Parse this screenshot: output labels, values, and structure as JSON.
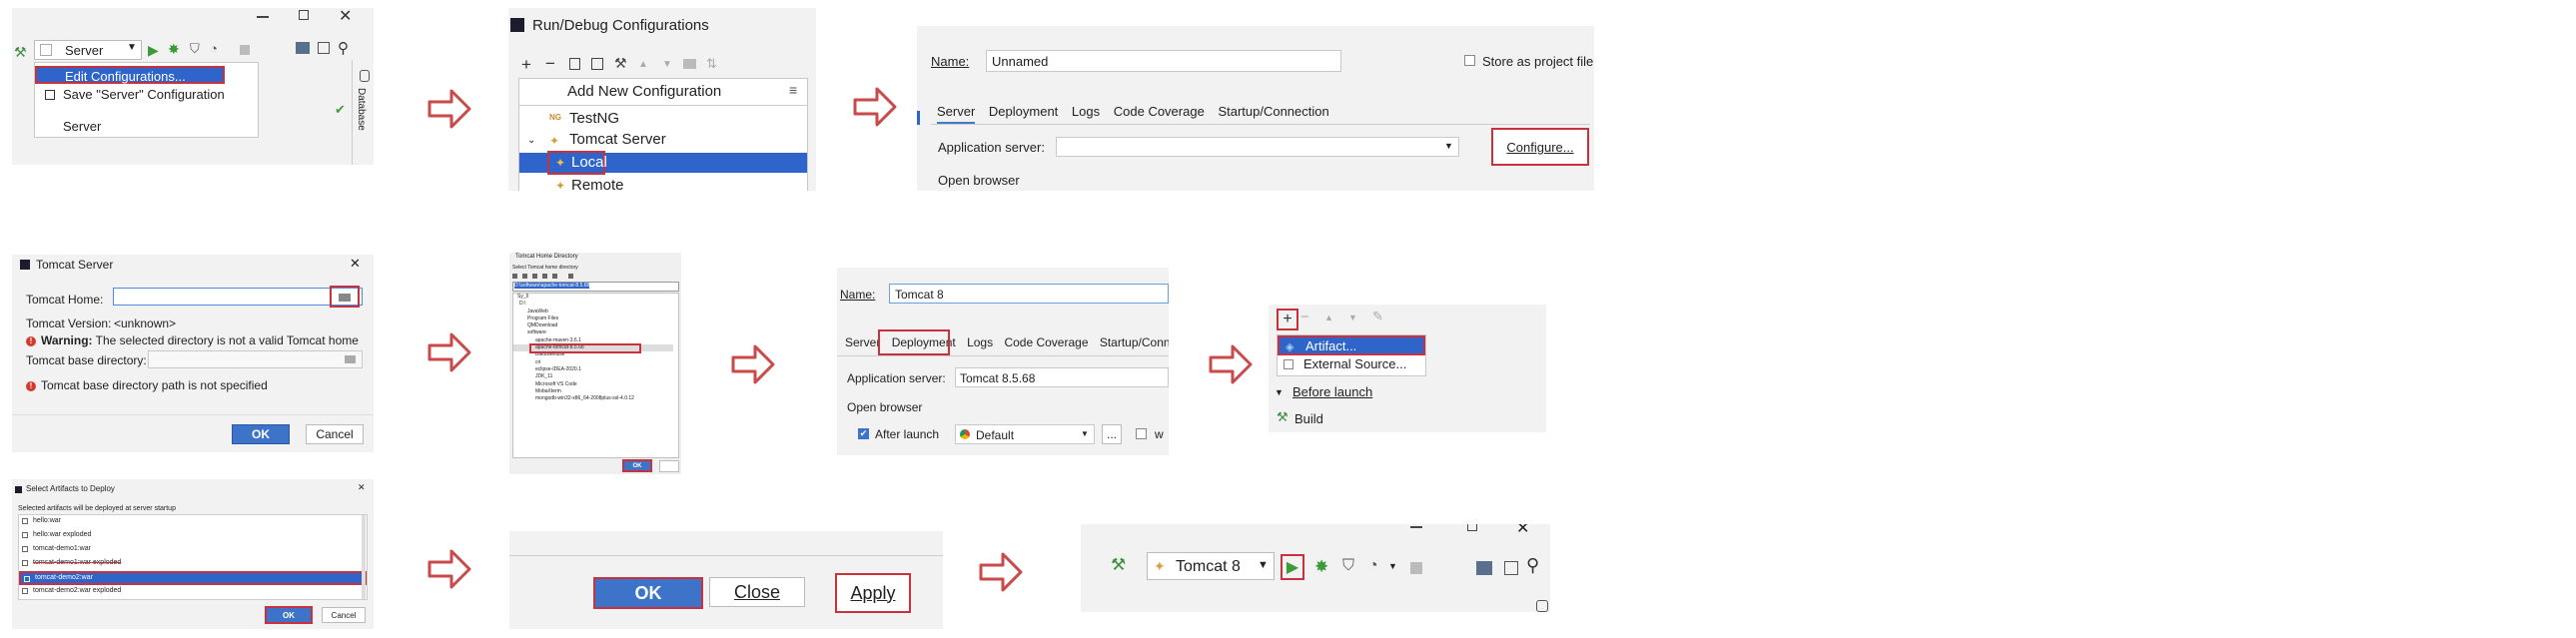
{
  "panel1": {
    "config_name": "Server",
    "menu_edit": "Edit Configurations...",
    "menu_save": "Save \"Server\" Configuration",
    "menu_server": "Server",
    "database_label": "Database"
  },
  "panel2": {
    "title": "Run/Debug Configurations",
    "add_new": "Add New Configuration",
    "testng": "TestNG",
    "tomcat_server": "Tomcat Server",
    "local": "Local",
    "remote": "Remote"
  },
  "panel3": {
    "name_label": "Name:",
    "name_value": "Unnamed",
    "store_label": "Store as project file",
    "tabs": [
      "Server",
      "Deployment",
      "Logs",
      "Code Coverage",
      "Startup/Connection"
    ],
    "app_server_label": "Application server:",
    "configure_btn": "Configure...",
    "open_browser": "Open browser"
  },
  "panel4": {
    "title": "Tomcat Server",
    "home_label": "Tomcat Home:",
    "version_label": "Tomcat Version:",
    "version_value": "<unknown>",
    "warning_bold": "Warning:",
    "warning_text": "The selected directory is not a valid Tomcat home",
    "base_label": "Tomcat base directory:",
    "base_error": "Tomcat base directory path is not specified",
    "ok": "OK",
    "cancel": "Cancel"
  },
  "panel5": {
    "title": "Tomcat Home Directory",
    "subtitle": "Select Tomcat home directory",
    "path": "D:\\software\\apache-tomcat-8.5.68",
    "tree": [
      "Sy_ll",
      "D:\\",
      "JavaWeb",
      "Program Files",
      "QMDownload",
      "software",
      "apache-maven-3.6.1",
      "apache-tomcat-8.5.68",
      "BaiduNetdisk",
      "cri",
      "eclipse-IDEA-2020.1",
      "JDK_11",
      "Microsoft VS Code",
      "MobaXterm",
      "mongodb-win32-x86_64-2008plus-ssl-4.0.12"
    ],
    "ok": "OK"
  },
  "panel6": {
    "name_label": "Name:",
    "name_value": "Tomcat 8",
    "tabs": [
      "Server",
      "Deployment",
      "Logs",
      "Code Coverage",
      "Startup/Connection"
    ],
    "app_server_label": "Application server:",
    "app_server_value": "Tomcat 8.5.68",
    "open_browser": "Open browser",
    "after_launch": "After launch",
    "browser": "Default",
    "more": "...",
    "w_label": "w"
  },
  "panel7": {
    "artifact": "Artifact...",
    "external_source": "External Source...",
    "before_launch": "Before launch",
    "build": "Build"
  },
  "panel8": {
    "title": "Select Artifacts to Deploy",
    "subtitle": "Selected artifacts will be deployed at server startup",
    "items": [
      "hello:war",
      "hello:war exploded",
      "tomcat-demo1:war",
      "tomcat-demo1:war exploded",
      "tomcat-demo2:war",
      "tomcat-demo2:war exploded"
    ],
    "ok": "OK",
    "cancel": "Cancel"
  },
  "panel9": {
    "ok": "OK",
    "close": "Close",
    "apply": "Apply"
  },
  "panel10": {
    "config_name": "Tomcat 8"
  },
  "colors": {
    "highlight": "#c8323c",
    "selection": "#2f65ca",
    "arrow": "#c84a4a",
    "ok_blue": "#3d74c9"
  }
}
